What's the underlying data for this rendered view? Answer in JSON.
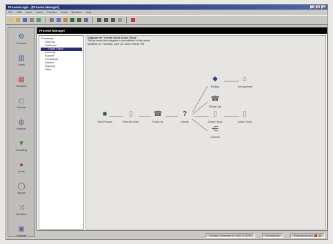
{
  "window": {
    "title": "ProcessLogic - [Process Manager]",
    "controls": [
      "_",
      "□",
      "×"
    ]
  },
  "menu": [
    "File",
    "Edit",
    "View",
    "Insert",
    "Process",
    "Tools",
    "Window",
    "Help"
  ],
  "toolbar": {
    "buttons": [
      {
        "name": "new",
        "color": "#e8c44a"
      },
      {
        "name": "open",
        "color": "#d9a43a"
      },
      {
        "name": "save",
        "color": "#4a6bc0"
      },
      {
        "name": "print",
        "color": "#8a8a8a"
      },
      {
        "name": "preview",
        "color": "#5a9a5a"
      },
      {
        "name": "cut",
        "color": "#7a7a7a"
      },
      {
        "name": "copy",
        "color": "#5a7ac0"
      },
      {
        "name": "paste",
        "color": "#c08a3a"
      },
      {
        "name": "undo",
        "color": "#3a6a3a"
      },
      {
        "name": "redo",
        "color": "#3a6a3a"
      },
      {
        "name": "find",
        "color": "#6a6a9a"
      },
      {
        "name": "zoom-in",
        "color": "#555"
      },
      {
        "name": "zoom-out",
        "color": "#555"
      },
      {
        "name": "grid",
        "color": "#555"
      },
      {
        "name": "page",
        "color": "#999"
      },
      {
        "name": "stop",
        "color": "#c03a3a"
      }
    ]
  },
  "sidebar": {
    "items": [
      {
        "label": "Processes",
        "icon": "processes-icon",
        "glyph": "⚙",
        "color": "#2a6a9a"
      },
      {
        "label": "Library",
        "icon": "library-icon",
        "glyph": "▥",
        "color": "#3a5aa0"
      },
      {
        "label": "Resources",
        "icon": "resources-icon",
        "glyph": "▦",
        "color": "#c04a3a"
      },
      {
        "label": "Calendar",
        "icon": "calendar-icon",
        "glyph": "◴",
        "color": "#4a8a4a"
      },
      {
        "label": "Inventory",
        "icon": "inventory-icon",
        "glyph": "◍",
        "color": "#5a5a9a"
      },
      {
        "label": "Forecasting",
        "icon": "forecast-icon",
        "glyph": "▼",
        "color": "#3a8a3a"
      },
      {
        "label": "Events",
        "icon": "events-icon",
        "glyph": "●",
        "color": "#c03a3a"
      },
      {
        "label": "Reports",
        "icon": "reports-icon",
        "glyph": "◯",
        "color": "#555"
      },
      {
        "label": "Simulation",
        "icon": "simulation-icon",
        "glyph": "⤨",
        "color": "#a03a6a"
      },
      {
        "label": "Templates",
        "icon": "templates-icon",
        "glyph": "▣",
        "color": "#6a5aa0"
      }
    ]
  },
  "panel": {
    "header": "Process Manager"
  },
  "tree": {
    "items": [
      {
        "label": "Processes",
        "level": 0,
        "selected": false
      },
      {
        "label": "Ordering",
        "level": 1,
        "selected": false
      },
      {
        "label": "Fulfillment",
        "level": 1,
        "selected": false
      },
      {
        "label": "Credit Check",
        "level": 2,
        "selected": true
      },
      {
        "label": "Invoicing",
        "level": 1,
        "selected": false
      },
      {
        "label": "Support",
        "level": 1,
        "selected": false
      },
      {
        "label": "Complaints",
        "level": 1,
        "selected": false
      },
      {
        "label": "Returns",
        "level": 1,
        "selected": false
      },
      {
        "label": "Shipping",
        "level": 1,
        "selected": false
      },
      {
        "label": "Other",
        "level": 1,
        "selected": false
      }
    ]
  },
  "info": {
    "title": "Diagram for \"Credit Check (Lead Time)\"",
    "line2": "This process flow diagram is not editable in this mode.",
    "line3": "Modified on: Tuesday, June 18, 2002 3:56:11 PM"
  },
  "flow": {
    "nodes": [
      {
        "id": "start",
        "label": "Start Process",
        "glyph": "■",
        "color": "#2a5a2a"
      },
      {
        "id": "receive",
        "label": "Receive Order",
        "glyph": "▯",
        "color": "#8a5ab0"
      },
      {
        "id": "followup",
        "label": "Follow Up",
        "glyph": "☎",
        "color": "#555"
      },
      {
        "id": "decide",
        "label": "Decide",
        "glyph": "?",
        "color": "#5a2a8a"
      },
      {
        "id": "routing",
        "label": "Routing",
        "glyph": "◆",
        "color": "#3a3aa0"
      },
      {
        "id": "getapproval",
        "label": "Get Approval",
        "glyph": "⌂",
        "color": "#555"
      },
      {
        "id": "phonecall",
        "label": "Phone Call",
        "glyph": "☎",
        "color": "#555"
      },
      {
        "id": "creditcheck1",
        "label": "Credit Check",
        "glyph": "▯",
        "color": "#8a5ab0"
      },
      {
        "id": "creditcheck2",
        "label": "Credit Check",
        "glyph": "▯",
        "color": "#8a5ab0"
      },
      {
        "id": "connect",
        "label": "Connect",
        "glyph": "⋲",
        "color": "#555"
      }
    ]
  },
  "status": {
    "datetime": "Tuesday, December 10, 2002 2:13 PM",
    "user": "Administrator",
    "mode": "ProgressIndicator"
  }
}
